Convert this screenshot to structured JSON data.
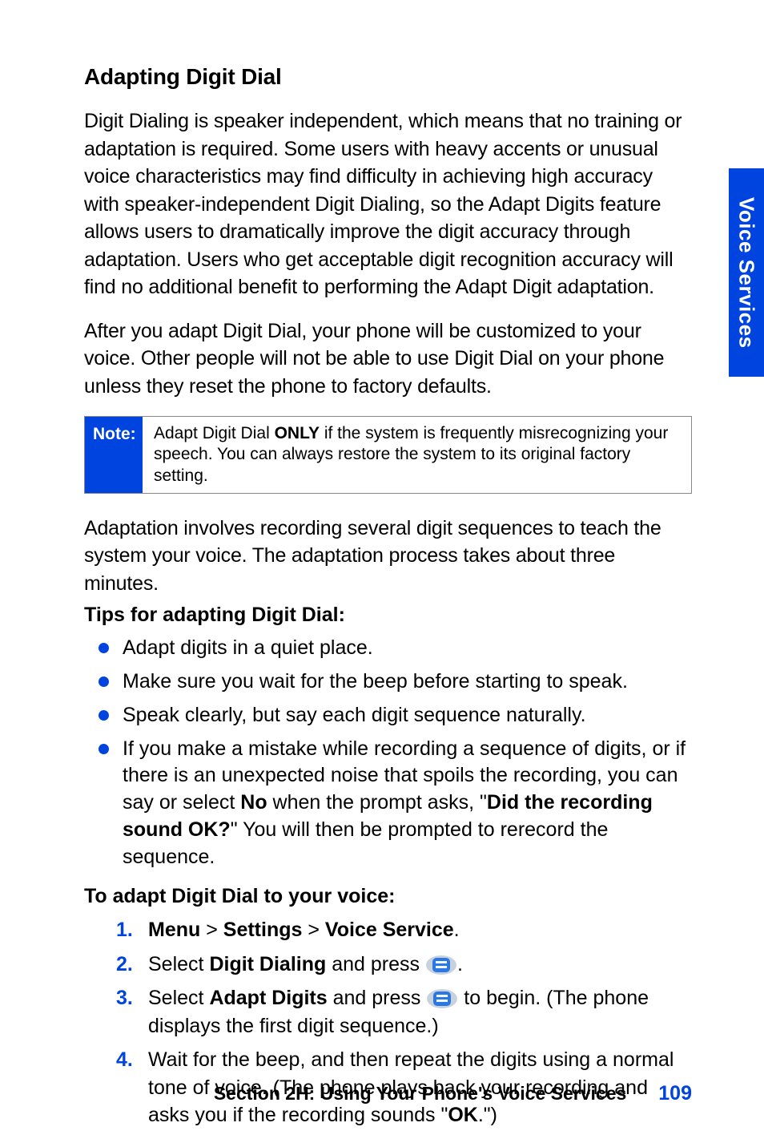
{
  "side_tab": "Voice Services",
  "heading": "Adapting Digit Dial",
  "para1": "Digit Dialing is speaker independent, which means that no training or adaptation is required. Some users with heavy accents or unusual voice characteristics may find difficulty in achieving high accuracy with speaker-independent Digit Dialing, so the Adapt Digits feature allows users to dramatically improve the digit accuracy through adaptation. Users who get acceptable digit recognition accuracy will find no additional benefit to performing the Adapt Digit adaptation.",
  "para2": "After you adapt Digit Dial, your phone will be customized to your voice. Other people will not be able to use Digit Dial on your phone unless they reset the phone to factory defaults.",
  "note_label": "Note:",
  "note_pre": "Adapt Digit Dial ",
  "note_bold": "ONLY",
  "note_post": " if the system is frequently misrecognizing your speech. You can always restore the system to its original factory setting.",
  "para3": "Adaptation involves recording several digit sequences to teach the system your voice. The adaptation process takes about three minutes.",
  "tips_head": "Tips for adapting Digit Dial:",
  "bullets": {
    "b1": "Adapt digits in a quiet place.",
    "b2": "Make sure you wait for the beep before starting to speak.",
    "b3": "Speak clearly, but say each digit sequence naturally.",
    "b4_pre": "If you make a mistake while recording a sequence of digits, or if there is an unexpected noise that spoils the recording, you can say or select ",
    "b4_no": "No",
    "b4_mid": " when the prompt asks, \"",
    "b4_did": "Did the recording sound OK?",
    "b4_post": "\" You will then be prompted to rerecord the sequence."
  },
  "toadapt_head": "To adapt Digit Dial to your voice:",
  "steps": {
    "s1": {
      "num": "1.",
      "menu": "Menu",
      "gt1": " > ",
      "settings": "Settings",
      "gt2": " > ",
      "vs": "Voice Service",
      "end": "."
    },
    "s2": {
      "num": "2.",
      "pre": "Select ",
      "dd": "Digit Dialing",
      "mid": " and press ",
      "end": "."
    },
    "s3": {
      "num": "3.",
      "pre": "Select ",
      "ad": "Adapt Digits",
      "mid": " and press ",
      "post": " to begin. (The phone displays the first digit sequence.)"
    },
    "s4": {
      "num": "4.",
      "pre": "Wait for the beep, and then repeat the digits using a normal tone of voice. (The phone plays back your recording and asks you if the recording sounds \"",
      "ok": "OK",
      "post": ".\")"
    }
  },
  "footer_section": "Section 2H: Using Your Phone's Voice Services",
  "footer_page": "109"
}
